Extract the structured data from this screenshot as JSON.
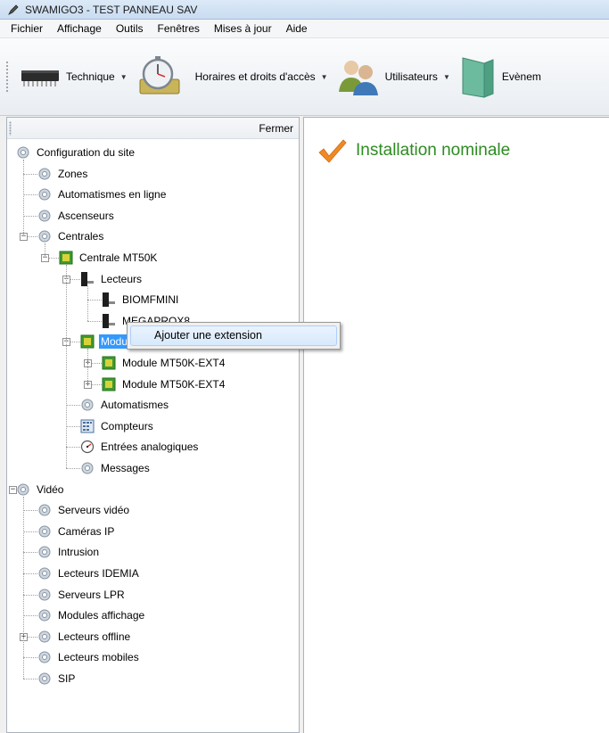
{
  "window": {
    "title": "SWAMIGO3 - TEST PANNEAU SAV"
  },
  "menubar": {
    "items": [
      "Fichier",
      "Affichage",
      "Outils",
      "Fenêtres",
      "Mises à jour",
      "Aide"
    ]
  },
  "toolbar": {
    "buttons": [
      {
        "label": "Technique",
        "icon": "chip-icon"
      },
      {
        "label": "Horaires et droits d'accès",
        "icon": "stopwatch-icon"
      },
      {
        "label": "Utilisateurs",
        "icon": "users-icon"
      },
      {
        "label": "Evènem",
        "icon": "door-icon"
      }
    ]
  },
  "leftpanel": {
    "close_label": "Fermer",
    "tree": [
      {
        "label": "Configuration du site",
        "icon": "gear-icon"
      },
      {
        "label": "Zones",
        "icon": "gear-icon"
      },
      {
        "label": "Automatismes en ligne",
        "icon": "gear-icon"
      },
      {
        "label": "Ascenseurs",
        "icon": "gear-icon"
      },
      {
        "label": "Centrales",
        "icon": "gear-icon",
        "expanded": true
      },
      {
        "label": "Centrale MT50K",
        "icon": "board-icon",
        "expanded": true
      },
      {
        "label": "Lecteurs",
        "icon": "reader-icon",
        "expanded": true
      },
      {
        "label": "BIOMFMINI",
        "icon": "reader-icon"
      },
      {
        "label": "MEGAPROX8",
        "icon": "reader-icon"
      },
      {
        "label": "Modules d'extension",
        "icon": "board-icon",
        "expanded": true,
        "selected": true
      },
      {
        "label": "Module MT50K-EXT4",
        "icon": "board-icon",
        "collapsed": true
      },
      {
        "label": "Module MT50K-EXT4",
        "icon": "board-icon",
        "collapsed": true
      },
      {
        "label": "Automatismes",
        "icon": "gear-icon"
      },
      {
        "label": "Compteurs",
        "icon": "counter-icon"
      },
      {
        "label": "Entrées analogiques",
        "icon": "gauge-icon"
      },
      {
        "label": "Messages",
        "icon": "gear-icon"
      },
      {
        "label": "Vidéo",
        "icon": "gear-icon",
        "expanded": true
      },
      {
        "label": "Serveurs vidéo",
        "icon": "gear-icon"
      },
      {
        "label": "Caméras IP",
        "icon": "gear-icon"
      },
      {
        "label": "Intrusion",
        "icon": "gear-icon"
      },
      {
        "label": "Lecteurs IDEMIA",
        "icon": "gear-icon"
      },
      {
        "label": "Serveurs LPR",
        "icon": "gear-icon"
      },
      {
        "label": "Modules affichage",
        "icon": "gear-icon"
      },
      {
        "label": "Lecteurs offline",
        "icon": "gear-icon",
        "collapsed": true
      },
      {
        "label": "Lecteurs mobiles",
        "icon": "gear-icon"
      },
      {
        "label": "SIP",
        "icon": "gear-icon"
      }
    ]
  },
  "context_menu": {
    "items": [
      "Ajouter une extension"
    ]
  },
  "main": {
    "status_text": "Installation nominale",
    "status_color": "#2e8b22",
    "check_color": "#f08a24"
  }
}
